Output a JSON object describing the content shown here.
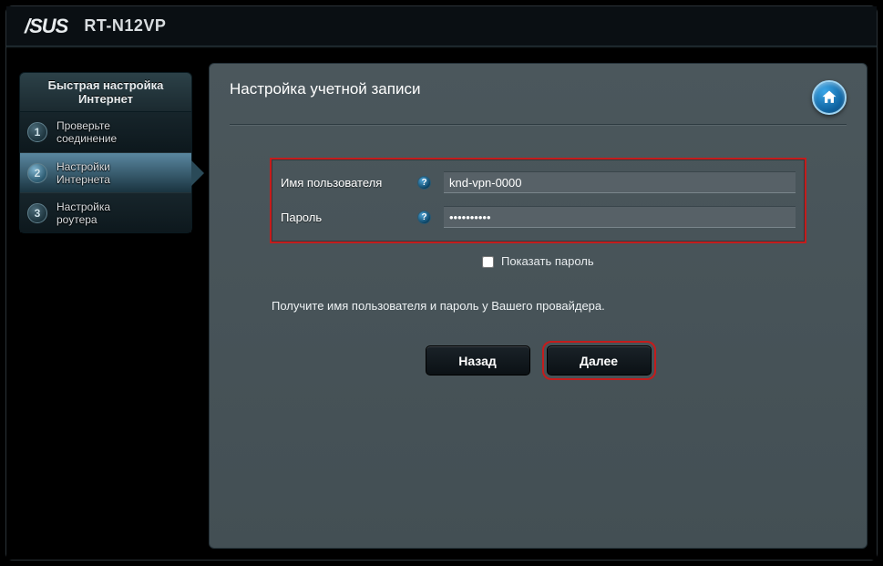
{
  "header": {
    "brand": "/SUS",
    "model": "RT-N12VP"
  },
  "sidebar": {
    "title_line1": "Быстрая настройка",
    "title_line2": "Интернет",
    "steps": [
      {
        "num": "1",
        "label_line1": "Проверьте",
        "label_line2": "соединение"
      },
      {
        "num": "2",
        "label_line1": "Настройки",
        "label_line2": "Интернета"
      },
      {
        "num": "3",
        "label_line1": "Настройка",
        "label_line2": "роутера"
      }
    ],
    "active_index": 1
  },
  "main": {
    "title": "Настройка учетной записи",
    "username_label": "Имя пользователя",
    "username_value": "knd-vpn-0000",
    "password_label": "Пароль",
    "password_value": "••••••••••",
    "show_password_label": "Показать пароль",
    "hint": "Получите имя пользователя и пароль у Вашего провайдера.",
    "back_label": "Назад",
    "next_label": "Далее",
    "help_glyph": "?"
  }
}
